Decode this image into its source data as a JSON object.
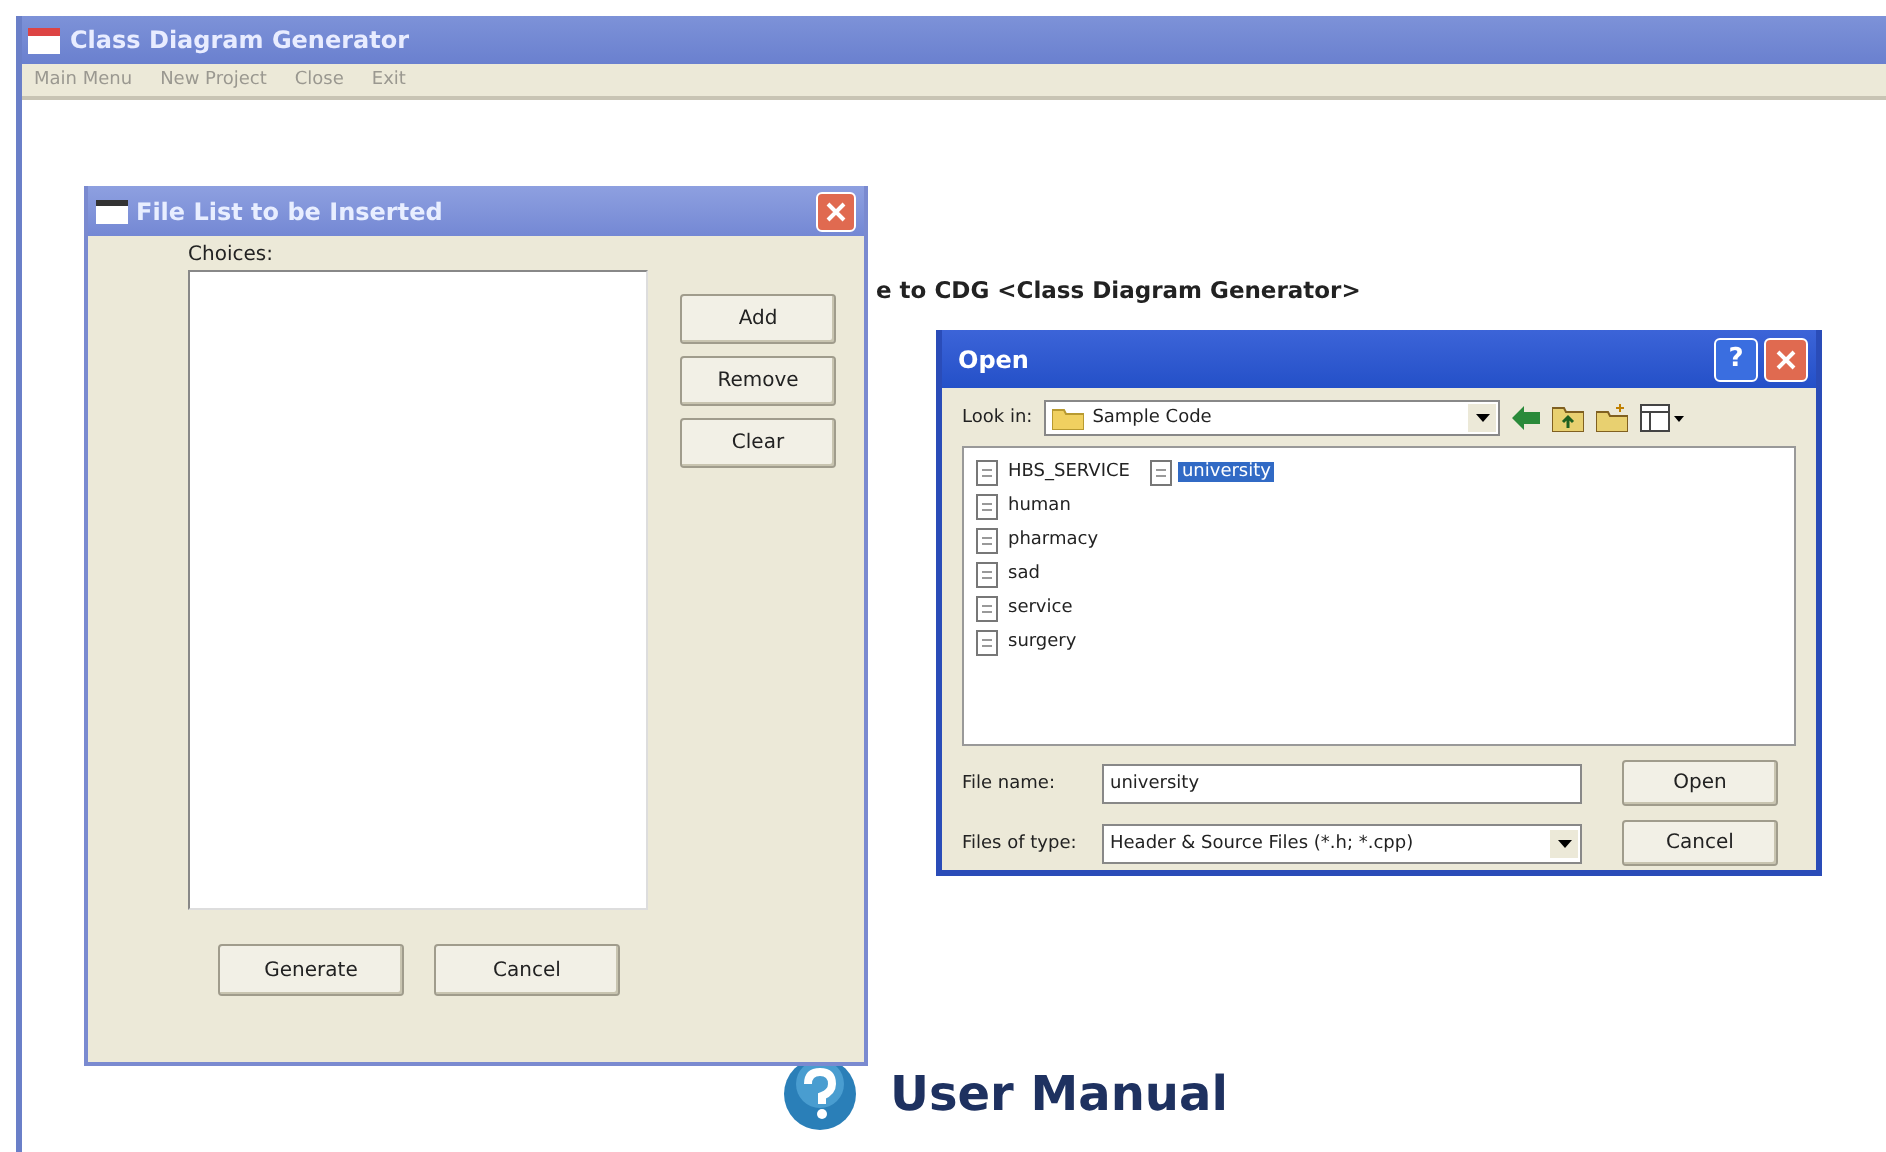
{
  "window": {
    "title": "Class Diagram Generator"
  },
  "menu": [
    {
      "label": "Main Menu"
    },
    {
      "label": "New Project"
    },
    {
      "label": "Close"
    },
    {
      "label": "Exit"
    }
  ],
  "welcome": "e to CDG <Class Diagram Generator>",
  "user_manual": "User Manual",
  "file_list_dialog": {
    "title": "File List to be Inserted",
    "choices_label": "Choices:",
    "side_buttons": [
      "Add",
      "Remove",
      "Clear"
    ],
    "bottom_buttons": [
      "Generate",
      "Cancel"
    ]
  },
  "open_dialog": {
    "title": "Open",
    "help": "?",
    "look_in_label": "Look in:",
    "look_in": "Sample Code",
    "files": [
      {
        "name": "HBS_SERVICE",
        "selected": false
      },
      {
        "name": "human",
        "selected": false
      },
      {
        "name": "pharmacy",
        "selected": false
      },
      {
        "name": "sad",
        "selected": false
      },
      {
        "name": "service",
        "selected": false
      },
      {
        "name": "surgery",
        "selected": false
      },
      {
        "name": "university",
        "selected": true
      }
    ],
    "file_name_label": "File name:",
    "file_name": "university",
    "type_label": "Files of type:",
    "type_value": "Header & Source Files (*.h; *.cpp)",
    "buttons": [
      "Open",
      "Cancel"
    ]
  }
}
